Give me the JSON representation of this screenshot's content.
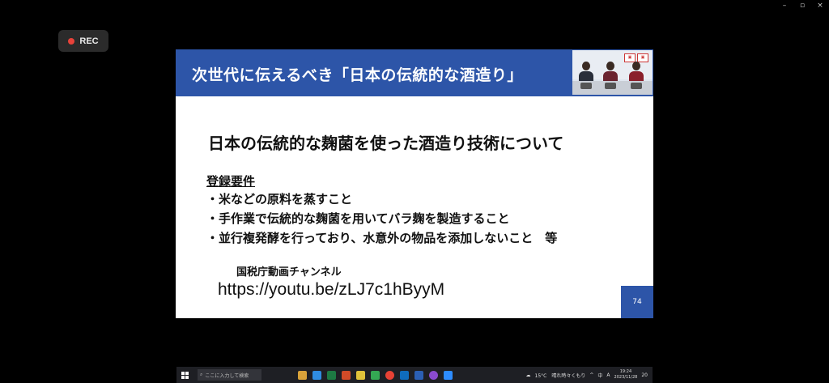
{
  "window": {
    "minimize": "–",
    "maximize": "▫",
    "close": "×"
  },
  "rec": {
    "label": "REC",
    "color": "#e8423a"
  },
  "slide": {
    "title": "次世代に伝えるべき「日本の伝統的な酒造り」",
    "heading": "日本の伝統的な麹菌を使った酒造り技術について",
    "requirements_title": "登録要件",
    "requirements": [
      "・米などの原料を蒸すこと",
      "・手作業で伝統的な麹菌を用いてバラ麹を製造すること",
      "・並行複発酵を行っており、水意外の物品を添加しないこと　等"
    ],
    "channel_label": "国税庁動画チャンネル",
    "url": "https://youtu.be/zLJ7c1hByyM",
    "page_number": "74",
    "header_color": "#2d55a8"
  },
  "taskbar": {
    "search_placeholder": "ここに入力して検索",
    "apps": [
      {
        "icon": "explorer-icon",
        "color": "#d9a23a"
      },
      {
        "icon": "edge-icon",
        "color": "#2f8ce0"
      },
      {
        "icon": "excel-icon",
        "color": "#1d7a43"
      },
      {
        "icon": "powerpoint-icon",
        "color": "#d14b28"
      },
      {
        "icon": "notes-icon",
        "color": "#e0c23a"
      },
      {
        "icon": "browser-icon",
        "color": "#34a853"
      },
      {
        "icon": "chrome-icon",
        "color": "#e94235"
      },
      {
        "icon": "outlook-icon",
        "color": "#0f6cbd"
      },
      {
        "icon": "word-icon",
        "color": "#2b5fb4"
      },
      {
        "icon": "media-icon",
        "color": "#8a4bd0"
      },
      {
        "icon": "zoom-icon",
        "color": "#2d8cff"
      }
    ],
    "weather": "15°C　晴れ時々くもり",
    "ime": "中",
    "ime_mode": "A",
    "time": "19:24",
    "date": "2023/11/28",
    "notification_count": "20"
  }
}
